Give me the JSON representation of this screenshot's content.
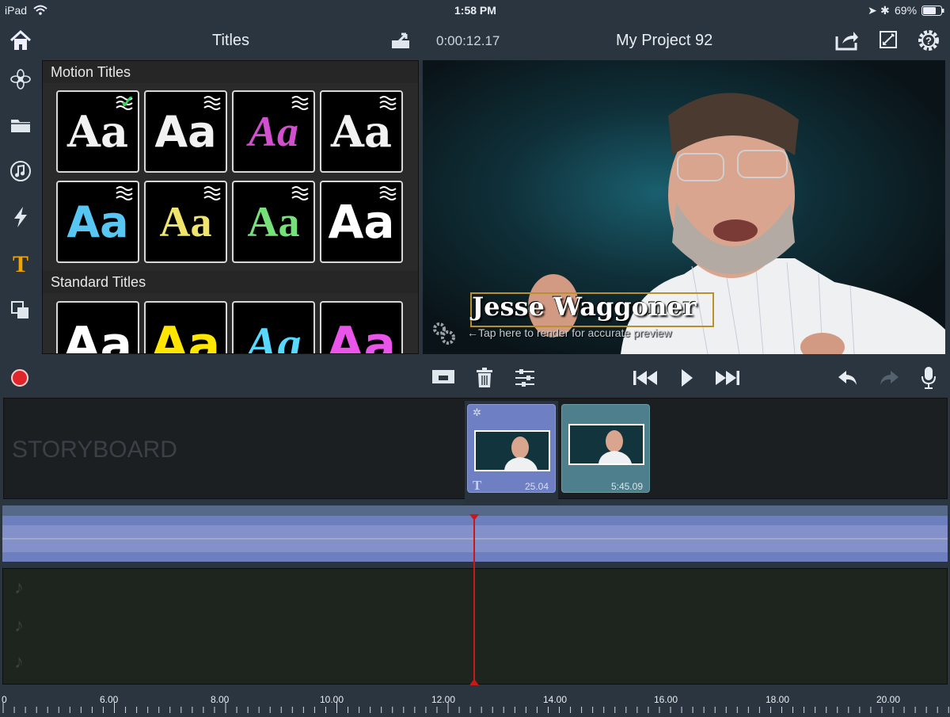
{
  "status_bar": {
    "device": "iPad",
    "time": "1:58 PM",
    "battery": "69%"
  },
  "header": {
    "panel_title": "Titles",
    "timecode": "0:00:12.17",
    "project_title": "My Project 92"
  },
  "browser": {
    "sections": [
      {
        "title": "Motion Titles"
      },
      {
        "title": "Standard Titles"
      }
    ],
    "tile_glyph": "Aa",
    "motion_tiles": [
      {
        "color": "#f2f2f2",
        "selected": true
      },
      {
        "color": "#f2f2f2",
        "selected": false
      },
      {
        "color": "#d24fd0",
        "selected": false
      },
      {
        "color": "#f2f2f2",
        "selected": false
      },
      {
        "color": "#58c6f2",
        "selected": false
      },
      {
        "color": "#f0e56a",
        "selected": false
      },
      {
        "color": "#76e07a",
        "selected": false
      },
      {
        "color": "#ffffff",
        "selected": false
      }
    ],
    "standard_tiles": [
      {
        "color": "#ffffff"
      },
      {
        "color": "#ffe600"
      },
      {
        "color": "#56d8ff"
      },
      {
        "color": "#e855e8"
      }
    ]
  },
  "preview": {
    "title_text": "Jesse Waggoner",
    "render_hint": "←Tap here to render for accurate preview"
  },
  "storyboard": {
    "label": "STORYBOARD",
    "clips": [
      {
        "duration": "25.04",
        "has_title": true
      },
      {
        "duration": "5:45.09",
        "has_title": false
      }
    ]
  },
  "ruler": {
    "ticks": [
      "0",
      "6.00",
      "8.00",
      "10.00",
      "12.00",
      "14.00",
      "16.00",
      "18.00",
      "20.00"
    ]
  },
  "colors": {
    "accent_title_icon": "#f0a500",
    "record": "#e0262b",
    "playhead": "#c81818",
    "clip_selected": "#6f7fc4",
    "clip_normal": "#4e7f8c"
  },
  "icons": {
    "home": "home-icon",
    "effects": "flower-icon",
    "media": "folder-icon",
    "music": "music-icon",
    "transitions": "lightning-icon",
    "titles": "title-t-icon",
    "overlays": "overlay-icon",
    "share": "share-icon",
    "settings": "edit-icon",
    "help": "help-gear-icon"
  }
}
